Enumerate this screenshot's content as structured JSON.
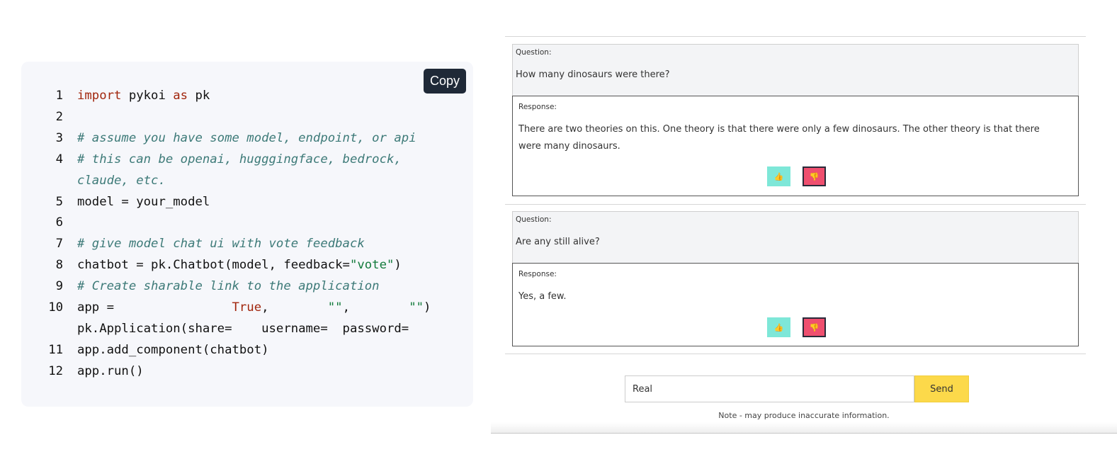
{
  "code_panel": {
    "copy_label": "Copy",
    "lines": [
      {
        "num": "1",
        "tokens": [
          {
            "t": "kw",
            "v": "import"
          },
          {
            "t": "tx",
            "v": " pykoi "
          },
          {
            "t": "kw",
            "v": "as"
          },
          {
            "t": "tx",
            "v": " pk"
          }
        ]
      },
      {
        "num": "2",
        "tokens": []
      },
      {
        "num": "3",
        "tokens": [
          {
            "t": "cm",
            "v": "# assume you have some model, endpoint, or api"
          }
        ]
      },
      {
        "num": "4",
        "tokens": [
          {
            "t": "cm",
            "v": "# this can be openai, hugggingface, bedrock,"
          }
        ]
      },
      {
        "num": "",
        "tokens": [
          {
            "t": "cm",
            "v": "claude, etc."
          }
        ]
      },
      {
        "num": "5",
        "tokens": [
          {
            "t": "tx",
            "v": "model = your_model"
          }
        ]
      },
      {
        "num": "6",
        "tokens": []
      },
      {
        "num": "7",
        "tokens": [
          {
            "t": "cm",
            "v": "# give model chat ui with vote feedback"
          }
        ]
      },
      {
        "num": "8",
        "tokens": [
          {
            "t": "tx",
            "v": "chatbot = pk.Chatbot(model, feedback="
          },
          {
            "t": "st",
            "v": "\"vote\""
          },
          {
            "t": "tx",
            "v": ")"
          }
        ]
      },
      {
        "num": "9",
        "tokens": [
          {
            "t": "cm",
            "v": "# Create sharable link to the application"
          }
        ]
      },
      {
        "num": "10",
        "tokens": [
          {
            "t": "tx",
            "v": "app =                "
          },
          {
            "t": "bl",
            "v": "True"
          },
          {
            "t": "tx",
            "v": ",        "
          },
          {
            "t": "st",
            "v": "\"\""
          },
          {
            "t": "tx",
            "v": ",        "
          },
          {
            "t": "st",
            "v": "\"\""
          },
          {
            "t": "tx",
            "v": ")"
          }
        ]
      },
      {
        "num": "",
        "tokens": [
          {
            "t": "tx",
            "v": "pk.Application(share=    username=  password="
          }
        ]
      },
      {
        "num": "11",
        "tokens": [
          {
            "t": "tx",
            "v": "app.add_component(chatbot)"
          }
        ]
      },
      {
        "num": "12",
        "tokens": [
          {
            "t": "tx",
            "v": "app.run()"
          }
        ]
      }
    ]
  },
  "chat": {
    "items": [
      {
        "question_label": "Question:",
        "question": "How many dinosaurs were there?",
        "response_label": "Response:",
        "response": "There are two theories on this. One theory is that there were only a few dinosaurs. The other theory is that there were many dinosaurs.",
        "upvote_icon": "thumbs-up-icon",
        "downvote_icon": "thumbs-down-icon"
      },
      {
        "question_label": "Question:",
        "question": "Are any still alive?",
        "response_label": "Response:",
        "response": "Yes, a few.",
        "upvote_icon": "thumbs-up-icon",
        "downvote_icon": "thumbs-down-icon"
      }
    ],
    "input_value": "Real",
    "send_label": "Send",
    "note": "Note - may produce inaccurate information."
  }
}
